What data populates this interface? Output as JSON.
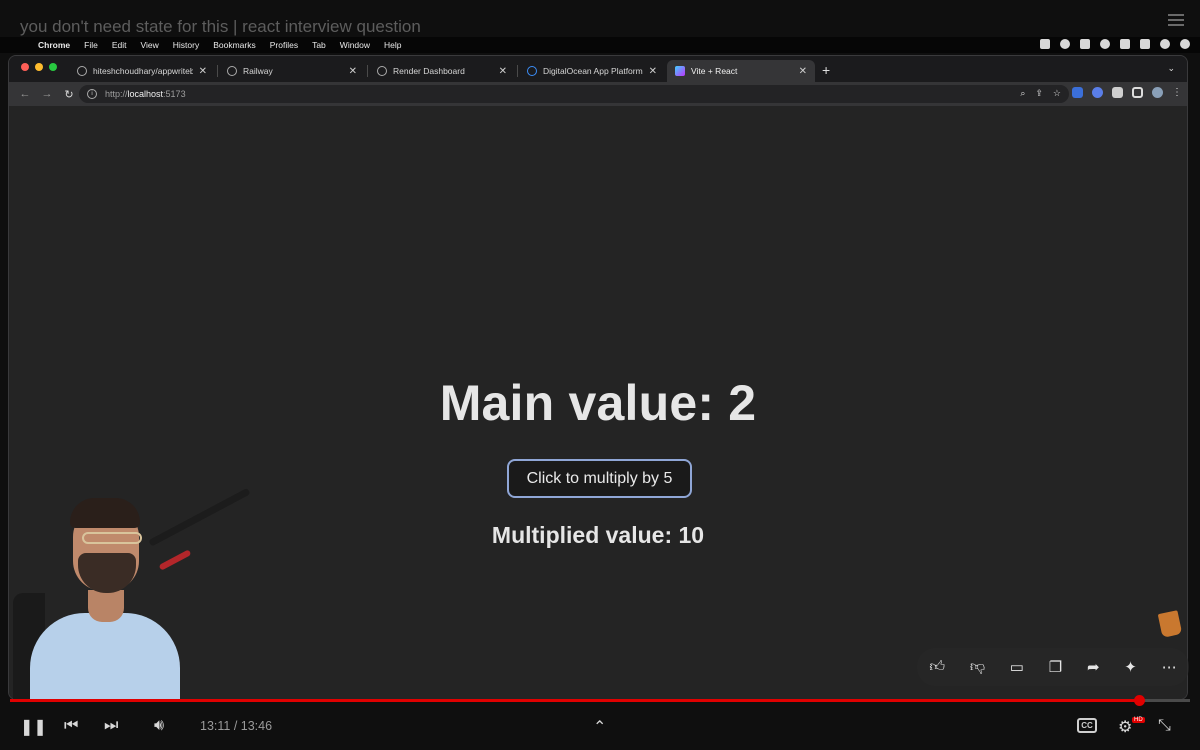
{
  "video": {
    "title": "you don't need state for this | react interview question",
    "time_current": "13:11",
    "time_separator": " / ",
    "time_total": "13:46",
    "progress_fraction": 0.957,
    "cc_label": "CC",
    "quality_badge": "HD"
  },
  "menubar": {
    "app": "Chrome",
    "items": [
      "File",
      "Edit",
      "View",
      "History",
      "Bookmarks",
      "Profiles",
      "Tab",
      "Window",
      "Help"
    ]
  },
  "tabs": [
    {
      "label": "hiteshchoudhary/appwriteblog",
      "icon": "github-icon"
    },
    {
      "label": "Railway",
      "icon": "railway-icon"
    },
    {
      "label": "Render Dashboard",
      "icon": "render-icon"
    },
    {
      "label": "DigitalOcean App Platform",
      "icon": "digitalocean-icon"
    },
    {
      "label": "Vite + React",
      "icon": "vite-icon",
      "active": true
    }
  ],
  "address_bar": {
    "scheme": "http://",
    "host": "localhost",
    "port": ":5173"
  },
  "app": {
    "main_label": "Main value: 2",
    "button_label": "Click to multiply by 5",
    "multiplied_label": "Multiplied value: 10"
  },
  "colors": {
    "accent_button_border": "#8fa6d6",
    "progress": "#e00000",
    "page_bg": "#242424"
  }
}
